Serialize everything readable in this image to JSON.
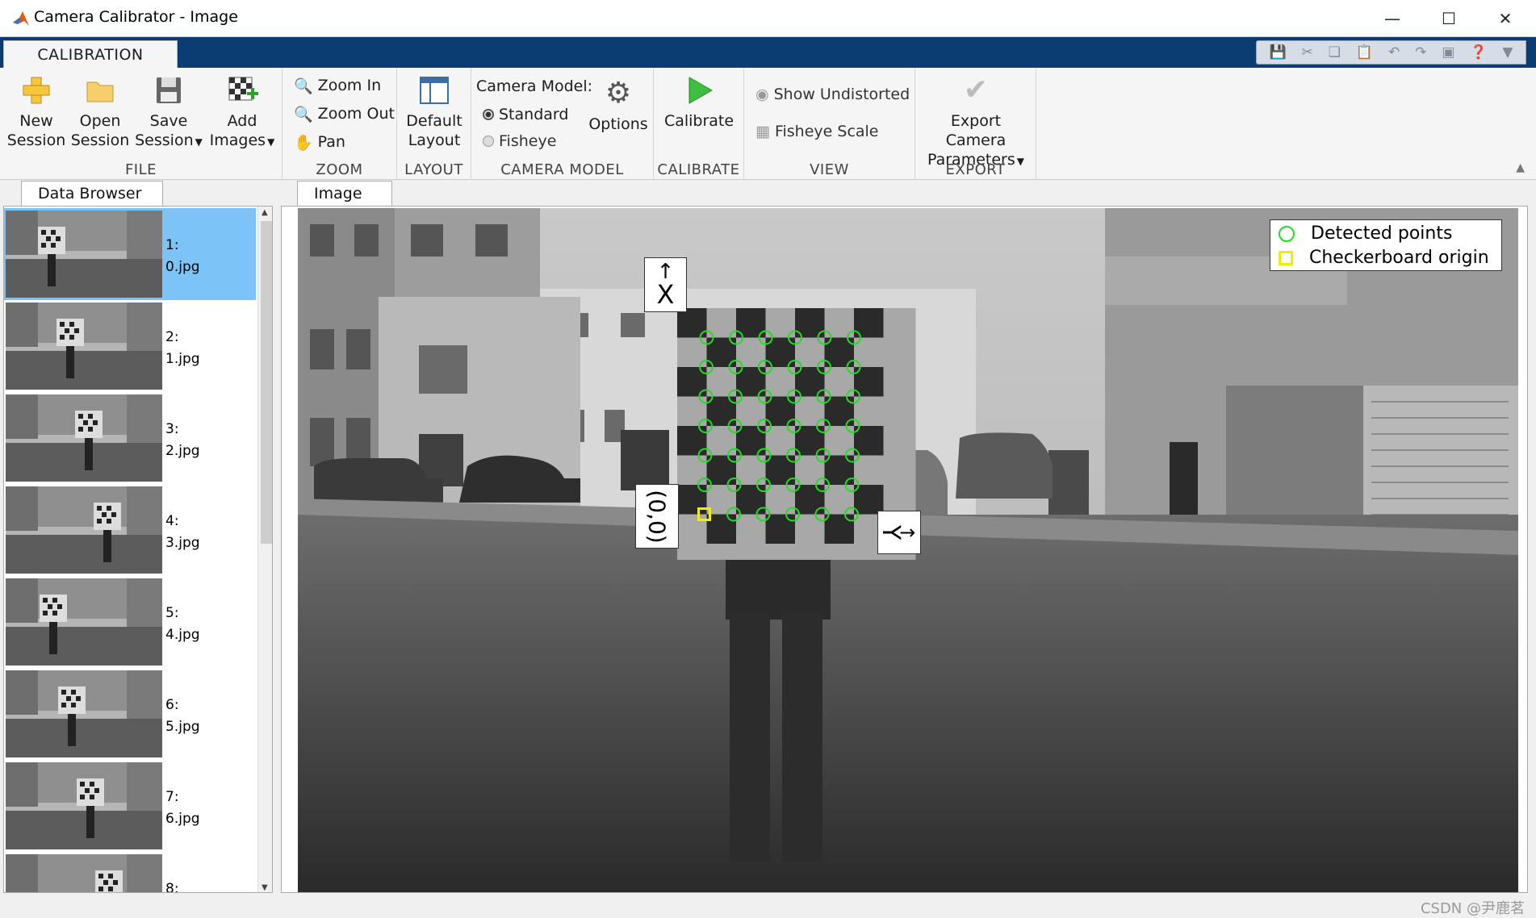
{
  "window": {
    "title": "Camera Calibrator - Image"
  },
  "tabs": {
    "active": "CALIBRATION"
  },
  "toolstrip": {
    "file": {
      "section_label": "FILE",
      "new_session": [
        "New",
        "Session"
      ],
      "open_session": [
        "Open",
        "Session"
      ],
      "save_session": [
        "Save",
        "Session"
      ],
      "add_images": [
        "Add",
        "Images"
      ]
    },
    "zoom": {
      "section_label": "ZOOM",
      "zoom_in": "Zoom In",
      "zoom_out": "Zoom Out",
      "pan": "Pan"
    },
    "layout": {
      "section_label": "LAYOUT",
      "default_layout": [
        "Default",
        "Layout"
      ]
    },
    "camera_model": {
      "section_label": "CAMERA MODEL",
      "label": "Camera Model:",
      "standard": "Standard",
      "fisheye": "Fisheye",
      "selected": "Standard",
      "options": "Options"
    },
    "calibrate": {
      "section_label": "CALIBRATE",
      "calibrate": "Calibrate"
    },
    "view": {
      "section_label": "VIEW",
      "show_undistorted": "Show Undistorted",
      "fisheye_scale": "Fisheye Scale"
    },
    "export": {
      "section_label": "EXPORT",
      "export_params": [
        "Export Camera",
        "Parameters"
      ]
    }
  },
  "data_browser": {
    "tab_label": "Data Browser",
    "items": [
      {
        "index": "1:",
        "file": "0.jpg",
        "selected": true
      },
      {
        "index": "2:",
        "file": "1.jpg"
      },
      {
        "index": "3:",
        "file": "2.jpg"
      },
      {
        "index": "4:",
        "file": "3.jpg"
      },
      {
        "index": "5:",
        "file": "4.jpg"
      },
      {
        "index": "6:",
        "file": "5.jpg"
      },
      {
        "index": "7:",
        "file": "6.jpg"
      },
      {
        "index": "8:",
        "file": ""
      }
    ]
  },
  "image_view": {
    "tab_label": "Image",
    "axis_x_label": "X",
    "axis_y_label": "Y",
    "origin_label": "(0,0)",
    "grid": {
      "rows": 7,
      "cols": 6
    },
    "legend": {
      "detected": "Detected points",
      "origin": "Checkerboard origin"
    },
    "colors": {
      "detected": "#22dd22",
      "origin": "#f2ee00"
    }
  },
  "watermark": "CSDN @尹鹿茗"
}
